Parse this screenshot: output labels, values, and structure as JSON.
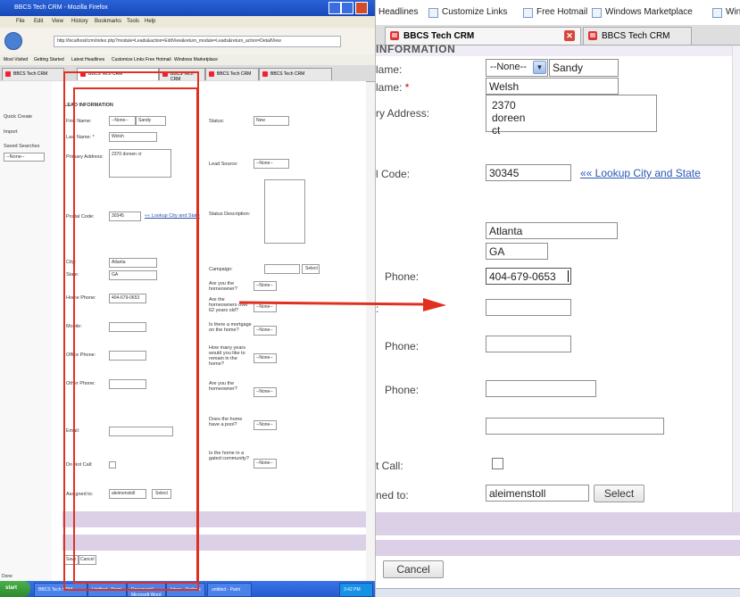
{
  "left": {
    "window_title": "BBCS Tech CRM - Mozilla Firefox",
    "menu": [
      "File",
      "Edit",
      "View",
      "History",
      "Bookmarks",
      "Tools",
      "Help"
    ],
    "url": "http://localhost/crm/index.php?module=Leads&action=EditView&return_module=Leads&return_action=DetailView",
    "bookmarks": [
      "Most Visited",
      "Getting Started",
      "Latest Headlines",
      "Customize Links",
      "Free Hotmail",
      "Windows Marketplace",
      "Windows Media"
    ],
    "tabs": [
      "BBCS Tech CRM",
      "BBCS Tech CRM",
      "BBCS Tech CRM",
      "BBCS Tech CRM",
      "BBCS Tech CRM"
    ],
    "sidebar": [
      "Quick Create",
      "Import",
      "Saved Searches",
      "--None--"
    ],
    "section_title": "LEAD INFORMATION",
    "fields_left": {
      "first_name": "First Name:",
      "first_name_sel": "--None--",
      "first_name_val": "Sandy",
      "last_name": "Last Name: *",
      "last_name_val": "Welsh",
      "primary_address": "Primary Address:",
      "primary_address_val": "2370 doreen ct",
      "postal_code": "Postal Code:",
      "postal_code_val": "30345",
      "lookup": "«« Lookup City and State",
      "city": "City:",
      "city_val": "Atlanta",
      "state": "State:",
      "state_val": "GA",
      "home_phone": "Home Phone:",
      "home_phone_val": "404-679-0653",
      "mobile": "Mobile:",
      "office_phone": "Office Phone:",
      "other_phone": "Other Phone:",
      "email": "Email:",
      "do_not_call": "Do Not Call:",
      "assigned_to": "Assigned to:",
      "assigned_val": "aleimenstoll",
      "select": "Select"
    },
    "fields_right": {
      "status": "Status:",
      "status_val": "New",
      "lead_source": "Lead Source:",
      "lead_source_val": "--None--",
      "status_description": "Status Description:",
      "campaign": "Campaign:",
      "campaign_select": "Select",
      "q1": "Are you the homeowner?",
      "q2": "Are the homeowners over 62 years old?",
      "q3": "Is there a mortgage on the home?",
      "q4": "How many years would you like to remain in the home?",
      "q5": "Are you the homeowner?",
      "q6": "Does the home have a pool?",
      "q7": "Is the home in a gated community?",
      "none": "--None--"
    },
    "buttons": {
      "save": "Save",
      "cancel": "Cancel"
    },
    "done": "Done",
    "start": "start",
    "taskbar_items": [
      "BBCS Tech CRM",
      "Untitled - Paint",
      "Document1 - Microsoft Word",
      "Inbox - Outlook",
      "untitled - Paint"
    ],
    "clock": "3:42 PM"
  },
  "right": {
    "bookmarks": [
      "Headlines",
      "Customize Links",
      "Free Hotmail",
      "Windows Marketplace",
      "Windows Media"
    ],
    "tabs": [
      "BBCS Tech CRM",
      "BBCS Tech CRM"
    ],
    "section_title": "INFORMATION",
    "labels": {
      "first_name": "lame:",
      "last_name": "lame:",
      "primary_address": "ry Address:",
      "postal_code": "l Code:",
      "home_phone": "Phone:",
      "mobile": ":",
      "office_phone": "Phone:",
      "other_phone": "Phone:",
      "do_not_call": "t Call:",
      "assigned_to": "ned to:"
    },
    "required_mark": "*",
    "values": {
      "salutation": "--None--",
      "first_name": "Sandy",
      "last_name": "Welsh",
      "address": "2370 doreen ct",
      "postal_code": "30345",
      "lookup_link": "«« Lookup City and State",
      "city": "Atlanta",
      "state": "GA",
      "home_phone": "404-679-0653",
      "assigned_to": "aleimenstoll"
    },
    "buttons": {
      "select": "Select",
      "cancel": "Cancel"
    }
  },
  "colors": {
    "annotation_red": "#e23020",
    "form_band": "#dcd0e6",
    "link_blue": "#2a58b6"
  }
}
